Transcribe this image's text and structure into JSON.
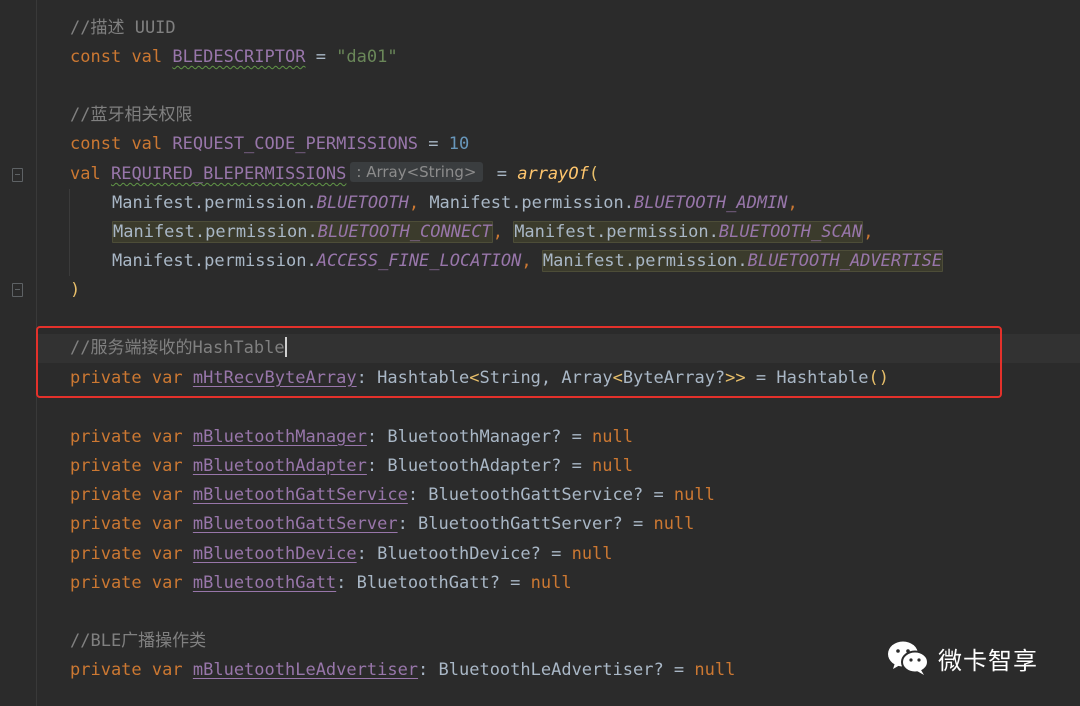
{
  "editor": {
    "inlay_hint": ": Array<String>",
    "lines": {
      "l1": {
        "comment": "//描述 UUID"
      },
      "l2": {
        "kw1": "const",
        "kw2": "val",
        "name": "BLEDESCRIPTOR",
        "eq": " = ",
        "value": "\"da01\""
      },
      "l3": {
        "comment": "//蓝牙相关权限"
      },
      "l4": {
        "kw1": "const",
        "kw2": "val",
        "name": "REQUEST_CODE_PERMISSIONS",
        "eq": " = ",
        "value": "10"
      },
      "l5": {
        "kw1": "val",
        "name": "REQUIRED_BLEPERMISSIONS",
        "eq": " = ",
        "fn": "arrayOf",
        "paren": "("
      },
      "l6": {
        "p1": "Manifest.permission.",
        "c1": "BLUETOOTH",
        "sep": ", ",
        "p2": "Manifest.permission.",
        "c2": "BLUETOOTH_ADMIN",
        "tail": ","
      },
      "l7": {
        "p1": "Manifest.permission.",
        "c1": "BLUETOOTH_CONNECT",
        "sep": ", ",
        "p2": "Manifest.permission.",
        "c2": "BLUETOOTH_SCAN",
        "tail": ","
      },
      "l8": {
        "p1": "Manifest.permission.",
        "c1": "ACCESS_FINE_LOCATION",
        "sep": ", ",
        "p2": "Manifest.permission.",
        "c2": "BLUETOOTH_ADVERTISE"
      },
      "l9": {
        "paren": ")"
      },
      "l10": {
        "comment": "//服务端接收的HashTable"
      },
      "l11": {
        "kw1": "private",
        "kw2": "var",
        "name": "mHtRecvByteArray",
        "colon": ": ",
        "t1": "Hashtable",
        "lt1": "<",
        "t2": "String, Array",
        "lt2": "<",
        "t3": "ByteArray?",
        "gt": ">>",
        "eq": " = ",
        "t4": "Hashtable",
        "call": "()"
      },
      "l12": {
        "kw1": "private",
        "kw2": "var",
        "name": "mBluetoothManager",
        "type": ": BluetoothManager? = ",
        "value": "null"
      },
      "l13": {
        "kw1": "private",
        "kw2": "var",
        "name": "mBluetoothAdapter",
        "type": ": BluetoothAdapter? = ",
        "value": "null"
      },
      "l14": {
        "kw1": "private",
        "kw2": "var",
        "name": "mBluetoothGattService",
        "type": ": BluetoothGattService? = ",
        "value": "null"
      },
      "l15": {
        "kw1": "private",
        "kw2": "var",
        "name": "mBluetoothGattServer",
        "type": ": BluetoothGattServer? = ",
        "value": "null"
      },
      "l16": {
        "kw1": "private",
        "kw2": "var",
        "name": "mBluetoothDevice",
        "type": ": BluetoothDevice? = ",
        "value": "null"
      },
      "l17": {
        "kw1": "private",
        "kw2": "var",
        "name": "mBluetoothGatt",
        "type": ": BluetoothGatt? = ",
        "value": "null"
      },
      "l18": {
        "comment": "//BLE广播操作类"
      },
      "l19": {
        "kw1": "private",
        "kw2": "var",
        "name": "mBluetoothLeAdvertiser",
        "type": ": BluetoothLeAdvertiser? = ",
        "value": "null"
      }
    }
  },
  "watermark": {
    "text": "微卡智享",
    "icon": "wechat-icon"
  },
  "colors": {
    "background": "#2b2b2b",
    "keyword": "#cc7832",
    "constant": "#9876aa",
    "string": "#6a8759",
    "number": "#6897bb",
    "comment": "#808080",
    "function": "#ffc66d",
    "annotation_box": "#e4312b"
  }
}
